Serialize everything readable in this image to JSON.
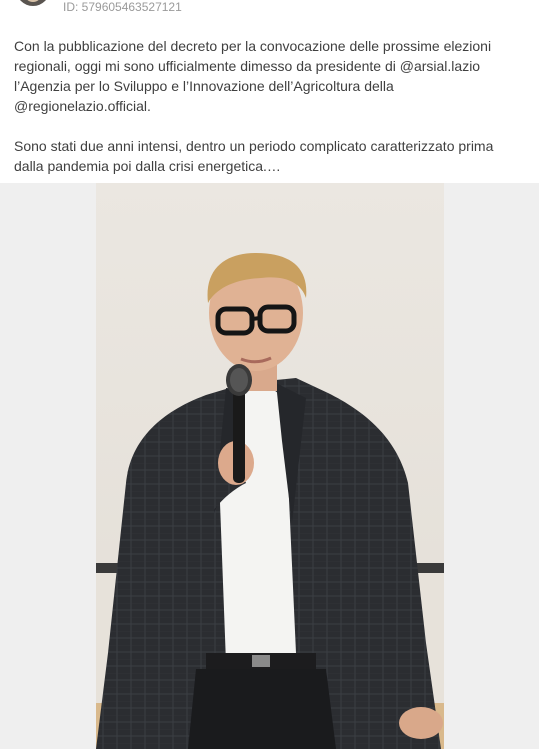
{
  "post": {
    "id_label": "ID: 579605463527121",
    "paragraphs": [
      "Con la pubblicazione del decreto per la convocazione delle prossime elezioni regionali, oggi mi sono ufficialmente dimesso da presidente di @arsial.lazio l’Agenzia per lo Sviluppo e l’Innovazione dell’Agricoltura della @regionelazio.official.",
      "Sono stati due anni intensi, dentro un periodo complicato caratterizzato prima dalla pandemia poi dalla crisi energetica.…"
    ]
  },
  "colors": {
    "text": "#3f3f3f",
    "muted": "#9a9a9a",
    "media_background": "#efefef",
    "wall": "#e8e4de",
    "jacket": "#2a2c30",
    "shirt": "#f4f4f2"
  },
  "media": {
    "icons": [
      "avatar",
      "speaker-photo"
    ]
  }
}
